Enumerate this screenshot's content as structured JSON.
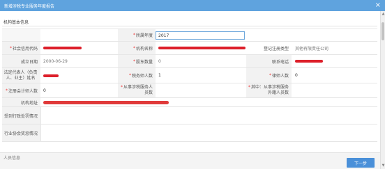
{
  "window": {
    "title": "新增涉税专业服务年度报告",
    "close_icon": "close-icon"
  },
  "section": {
    "title": "机构基本信息"
  },
  "fields": {
    "report_year": {
      "label": "所属年度",
      "value": "2017"
    },
    "credit_code": {
      "label": "社会信用代码"
    },
    "org_name": {
      "label": "机构名称"
    },
    "register_type": {
      "label": "登记注册类型",
      "value": "其他有限责任公司"
    },
    "setup_date": {
      "label": "成立日期",
      "value": "2000-06-29"
    },
    "shareholders": {
      "label": "股东数量",
      "value": "0"
    },
    "phone": {
      "label": "联系电话"
    },
    "legal_rep": {
      "label": "法定代表人（负责人、业主）姓名"
    },
    "tax_agents": {
      "label": "税务师人数",
      "value": "1"
    },
    "lawyers": {
      "label": "律师人数",
      "value": "0"
    },
    "accountants": {
      "label": "注册会计师人数",
      "value": "0"
    },
    "staff": {
      "label": "从事涉税服务人员数"
    },
    "other_staff": {
      "label": "其中：从事涉税服务外籍人员数"
    },
    "address": {
      "label": "机构地址"
    },
    "penalty": {
      "label": "受到行政处罚情况"
    },
    "self_discipline": {
      "label": "行业协会奖惩情况"
    }
  },
  "footer": {
    "next_label": "下一步",
    "cut_section": "人员信息"
  }
}
